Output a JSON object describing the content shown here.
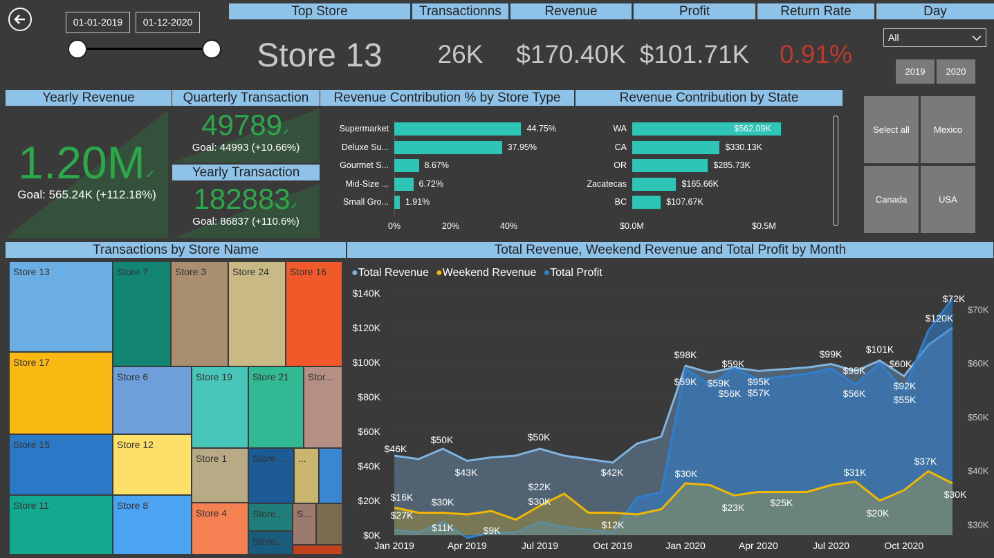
{
  "nav": {
    "back_icon": "back-arrow-icon"
  },
  "date_range": {
    "start": "01-01-2019",
    "end": "01-12-2020"
  },
  "kpi_headers": [
    "Top Store",
    "Transactionns",
    "Revenue",
    "Profit",
    "Return Rate",
    "Day"
  ],
  "kpi_values": {
    "top_store": "Store 13",
    "transactions": "26K",
    "revenue": "$170.40K",
    "profit": "$101.71K",
    "return_rate": "0.91%"
  },
  "day_filter": {
    "selected": "All",
    "years": [
      "2019",
      "2020"
    ]
  },
  "yearly_revenue": {
    "title": "Yearly Revenue",
    "value": "1.20M",
    "goal": "Goal: 565.24K (+112.18%)"
  },
  "quarterly_transaction": {
    "title": "Quarterly Transaction",
    "value": "49789",
    "goal": "Goal: 44993 (+10.66%)"
  },
  "yearly_transaction": {
    "title": "Yearly Transaction",
    "value": "182883",
    "goal": "Goal: 86837 (+110.6%)"
  },
  "store_type_chart": {
    "title": "Revenue Contribution % by Store Type",
    "categories": [
      "Supermarket",
      "Deluxe Su...",
      "Gourmet S...",
      "Mid-Size ...",
      "Small Gro..."
    ],
    "values": [
      44.75,
      37.95,
      8.67,
      6.72,
      1.91
    ],
    "labels": [
      "44.75%",
      "37.95%",
      "8.67%",
      "6.72%",
      "1.91%"
    ],
    "ticks": [
      "0%",
      "20%",
      "40%"
    ]
  },
  "state_chart": {
    "title": "Revenue Contribution by State",
    "categories": [
      "WA",
      "CA",
      "OR",
      "Zacatecas",
      "BC"
    ],
    "values": [
      562.09,
      330.13,
      285.73,
      165.66,
      107.67
    ],
    "labels": [
      "$562.09K",
      "$330.13K",
      "$285.73K",
      "$165.66K",
      "$107.67K"
    ],
    "ticks": [
      "$0.0M",
      "$0.5M"
    ]
  },
  "country_tiles": [
    "Select all",
    "Mexico",
    "Canada",
    "USA"
  ],
  "treemap": {
    "title": "Transactions by Store Name",
    "stores": [
      "Store 13",
      "Store 7",
      "Store 3",
      "Store 24",
      "Store 16",
      "Store 17",
      "Store 6",
      "Store 19",
      "Store 21",
      "Stor...",
      "Store 15",
      "Store 12",
      "Store 1",
      "Store ...",
      "...",
      "Store 11",
      "Store 8",
      "Store 4",
      "Store...",
      "S...",
      "Store..."
    ]
  },
  "colors": {
    "accent": "#8fc2e8",
    "teal": "#2ec4b6",
    "green": "#2ca84b",
    "red": "#c0392b",
    "total_revenue": "#7fb3e0",
    "weekend_revenue": "#f2b800",
    "total_profit": "#2f7fd1"
  },
  "chart_data": {
    "type": "area",
    "title": "Total Revenue, Weekend Revenue and Total Profit by Month",
    "x": [
      "Jan 2019",
      "Feb 2019",
      "Mar 2019",
      "Apr 2019",
      "May 2019",
      "Jun 2019",
      "Jul 2019",
      "Aug 2019",
      "Sep 2019",
      "Oct 2019",
      "Nov 2019",
      "Dec 2019",
      "Jan 2020",
      "Feb 2020",
      "Mar 2020",
      "Apr 2020",
      "May 2020",
      "Jun 2020",
      "Jul 2020",
      "Aug 2020",
      "Sep 2020",
      "Oct 2020",
      "Nov 2020",
      "Dec 2020"
    ],
    "x_ticks": [
      "Jan 2019",
      "Apr 2019",
      "Jul 2019",
      "Oct 2019",
      "Jan 2020",
      "Apr 2020",
      "Jul 2020",
      "Oct 2020"
    ],
    "y_ticks": [
      "$0K",
      "$20K",
      "$40K",
      "$60K",
      "$80K",
      "$100K",
      "$120K",
      "$140K"
    ],
    "y2_ticks": [
      "$30K",
      "$40K",
      "$50K",
      "$60K",
      "$70K"
    ],
    "ylim": [
      0,
      140
    ],
    "y2lim": [
      28,
      73
    ],
    "legend_position": "top-left",
    "series": [
      {
        "name": "Total Revenue",
        "axis": "left",
        "values": [
          46,
          44,
          50,
          43,
          45,
          46,
          50,
          46,
          44,
          42,
          53,
          57,
          98,
          94,
          97,
          95,
          96,
          97,
          99,
          95,
          101,
          92,
          110,
          120
        ]
      },
      {
        "name": "Weekend Revenue",
        "axis": "left",
        "values": [
          16,
          13,
          13,
          12,
          14,
          9,
          17,
          24,
          13,
          13,
          12,
          15,
          30,
          29,
          23,
          25,
          25,
          25,
          29,
          31,
          20,
          26,
          37,
          30
        ]
      },
      {
        "name": "Total Profit",
        "axis": "right",
        "values": [
          29,
          28.5,
          30.5,
          27.5,
          28.5,
          28.5,
          30.5,
          29.5,
          29,
          28.5,
          35,
          36,
          59,
          56,
          59,
          57,
          57.5,
          58,
          59,
          56,
          60,
          55,
          66,
          72
        ]
      }
    ],
    "annotations": [
      "$46K",
      "$50K",
      "$43K",
      "$50K",
      "$42K",
      "$98K",
      "$59K",
      "$99K",
      "$101K",
      "$120K",
      "$59K",
      "$56K",
      "$95K",
      "$57K",
      "$59K",
      "$95K",
      "$56K",
      "$60K",
      "$92K",
      "$55K",
      "$72K",
      "$16K",
      "$27K",
      "$30K",
      "$11K",
      "$9K",
      "$22K",
      "$30K",
      "$12K",
      "$30K",
      "$23K",
      "$25K",
      "$31K",
      "$20K",
      "$37K",
      "$30K"
    ]
  }
}
